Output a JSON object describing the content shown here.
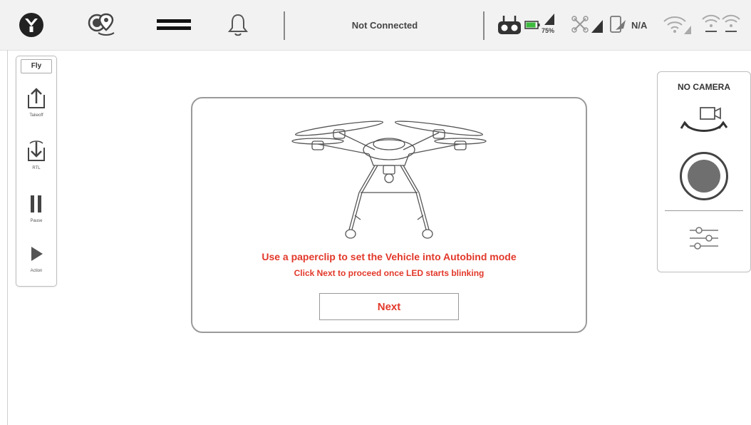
{
  "topbar": {
    "connection_status": "Not Connected",
    "battery_percent": "75%",
    "gps_status": "N/A",
    "icons": {
      "logo": "app-logo-icon",
      "vehicle_map": "vehicle-map-pin-icon",
      "menu": "menu-icon",
      "notifications": "bell-icon",
      "remote_controller": "remote-controller-icon",
      "battery": "battery-icon",
      "vehicle_signal": "vehicle-signal-icon",
      "drone_signal": "drone-signal-icon",
      "gps": "gps-icon",
      "wifi": "wifi-icon",
      "wifi_dual": "wifi-dual-icon"
    }
  },
  "left_toolbar": {
    "mode_tab": "Fly",
    "buttons": [
      {
        "label": "Takeoff",
        "icon": "takeoff-icon"
      },
      {
        "label": "RTL",
        "icon": "rtl-icon"
      },
      {
        "label": "Pause",
        "icon": "pause-icon"
      },
      {
        "label": "Action",
        "icon": "play-icon"
      }
    ]
  },
  "wizard": {
    "image_icon": "drone-icon",
    "instruction_line1": "Use a paperclip to set the Vehicle into Autobind mode",
    "instruction_line2": "Click Next to proceed once LED starts blinking",
    "next_label": "Next"
  },
  "camera_panel": {
    "title": "NO CAMERA",
    "icons": {
      "switch": "camera-switch-icon",
      "record": "record-icon",
      "settings": "sliders-icon"
    }
  },
  "colors": {
    "accent_red": "#e2382a",
    "battery_green": "#3dbb3d",
    "topbar_bg": "#f2f2f2"
  }
}
